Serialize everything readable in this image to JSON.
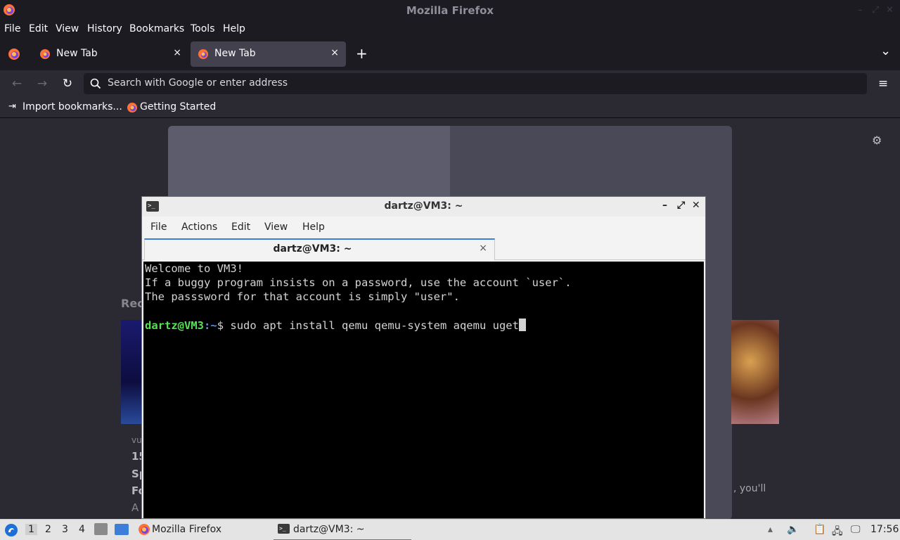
{
  "firefox": {
    "window_title": "Mozilla Firefox",
    "menu": [
      "File",
      "Edit",
      "View",
      "History",
      "Bookmarks",
      "Tools",
      "Help"
    ],
    "tabs": [
      {
        "label": "New Tab",
        "close": "×"
      },
      {
        "label": "New Tab",
        "close": "×"
      }
    ],
    "new_tab_button": "+",
    "tab_overflow": "⌄",
    "nav": {
      "back": "←",
      "forward": "→",
      "reload": "↻",
      "menu": "≡"
    },
    "search": {
      "placeholder": "Search with Google or enter address"
    },
    "bookmarks": [
      {
        "label": "Import bookmarks...",
        "icon": "import-icon"
      },
      {
        "label": "Getting Started",
        "icon": "firefox-icon"
      }
    ],
    "content": {
      "recommended_label": "Rec",
      "story_lines": [
        "vu",
        "15",
        "Sp",
        "Fo",
        "A"
      ],
      "story_faint": ", you'll"
    }
  },
  "terminal": {
    "title": "dartz@VM3: ~",
    "menu": [
      "File",
      "Actions",
      "Edit",
      "View",
      "Help"
    ],
    "tab_label": "dartz@VM3: ~",
    "tab_close": "×",
    "controls": {
      "minimize": "–",
      "maximize": "⤢",
      "close": "✕"
    },
    "lines": [
      "Welcome to VM3!",
      "If a buggy program insists on a password, use the account `user`.",
      "The passsword for that account is simply \"user\"."
    ],
    "prompt_user": "dartz@VM3",
    "prompt_colon": ":",
    "prompt_path": "~",
    "prompt_symbol": "$ ",
    "command": "sudo apt install qemu qemu-system aqemu uget"
  },
  "taskbar": {
    "workspaces": [
      "1",
      "2",
      "3",
      "4"
    ],
    "tasks": [
      {
        "label": "Mozilla Firefox",
        "icon": "firefox-icon"
      },
      {
        "label": "dartz@VM3: ~",
        "icon": "terminal-icon"
      }
    ],
    "clock": "17:56"
  },
  "colors": {
    "accent": "#3d7fd8",
    "prompt_user": "#55e055",
    "prompt_path": "#5a8ff0"
  }
}
